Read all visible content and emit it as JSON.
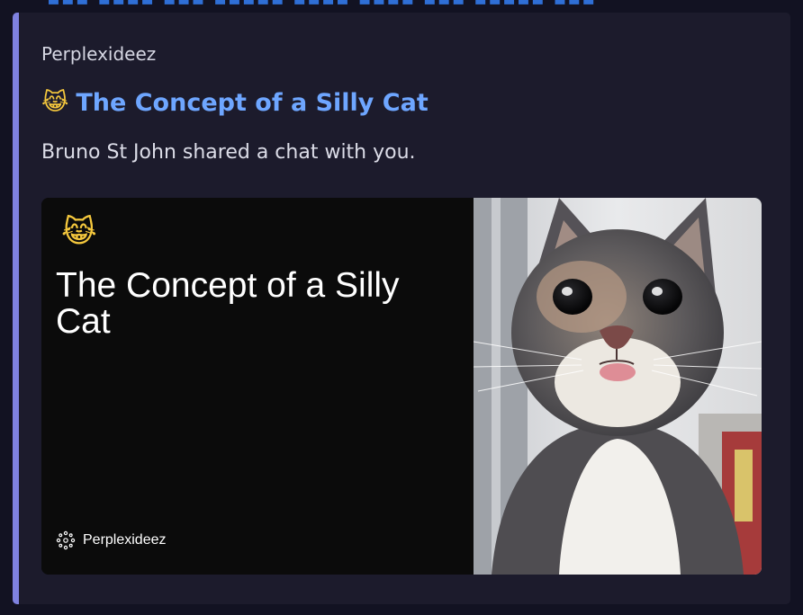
{
  "embed": {
    "provider": "Perplexideez",
    "title_emoji": "😹",
    "title": "The Concept of a Silly Cat",
    "description": "Bruno St John shared a chat with you."
  },
  "card": {
    "emoji": "😹",
    "title": "The Concept of a Silly Cat",
    "brand": "Perplexideez",
    "brand_icon": "perplexideez-logo-icon",
    "image": "cat-photo"
  },
  "colors": {
    "accent_bar": "#7f82e0",
    "title_link": "#6ea6ff",
    "embed_bg": "#1c1b2c"
  }
}
